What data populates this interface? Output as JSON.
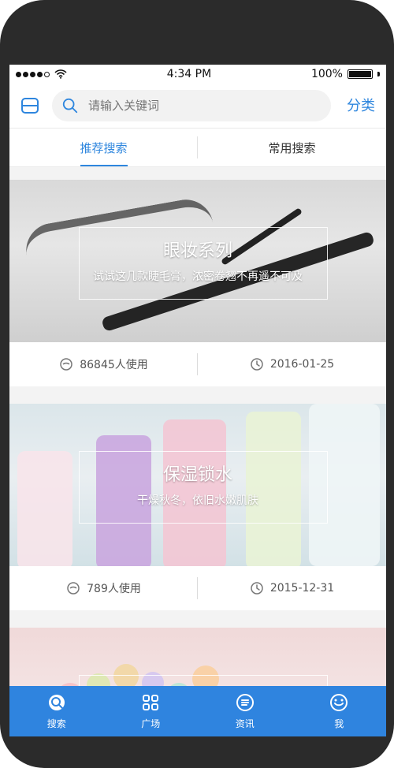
{
  "status": {
    "time": "4:34 PM",
    "battery": "100%"
  },
  "top": {
    "search_placeholder": "请输入关键词",
    "category_label": "分类"
  },
  "tabs": [
    {
      "label": "推荐搜索",
      "active": true
    },
    {
      "label": "常用搜索",
      "active": false
    }
  ],
  "cards": [
    {
      "title": "眼妆系列",
      "subtitle": "试试这几款睫毛膏，浓密卷翘不再遥不可及",
      "usage": "86845人使用",
      "date": "2016-01-25"
    },
    {
      "title": "保湿锁水",
      "subtitle": "干燥秋冬，依旧水嫩肌肤",
      "usage": "789人使用",
      "date": "2015-12-31"
    }
  ],
  "bottom_nav": [
    {
      "label": "搜索",
      "icon": "search-icon"
    },
    {
      "label": "广场",
      "icon": "grid-icon"
    },
    {
      "label": "资讯",
      "icon": "news-icon"
    },
    {
      "label": "我",
      "icon": "profile-icon"
    }
  ],
  "colors": {
    "accent": "#2e86de",
    "nav_bg": "#2f84df"
  }
}
